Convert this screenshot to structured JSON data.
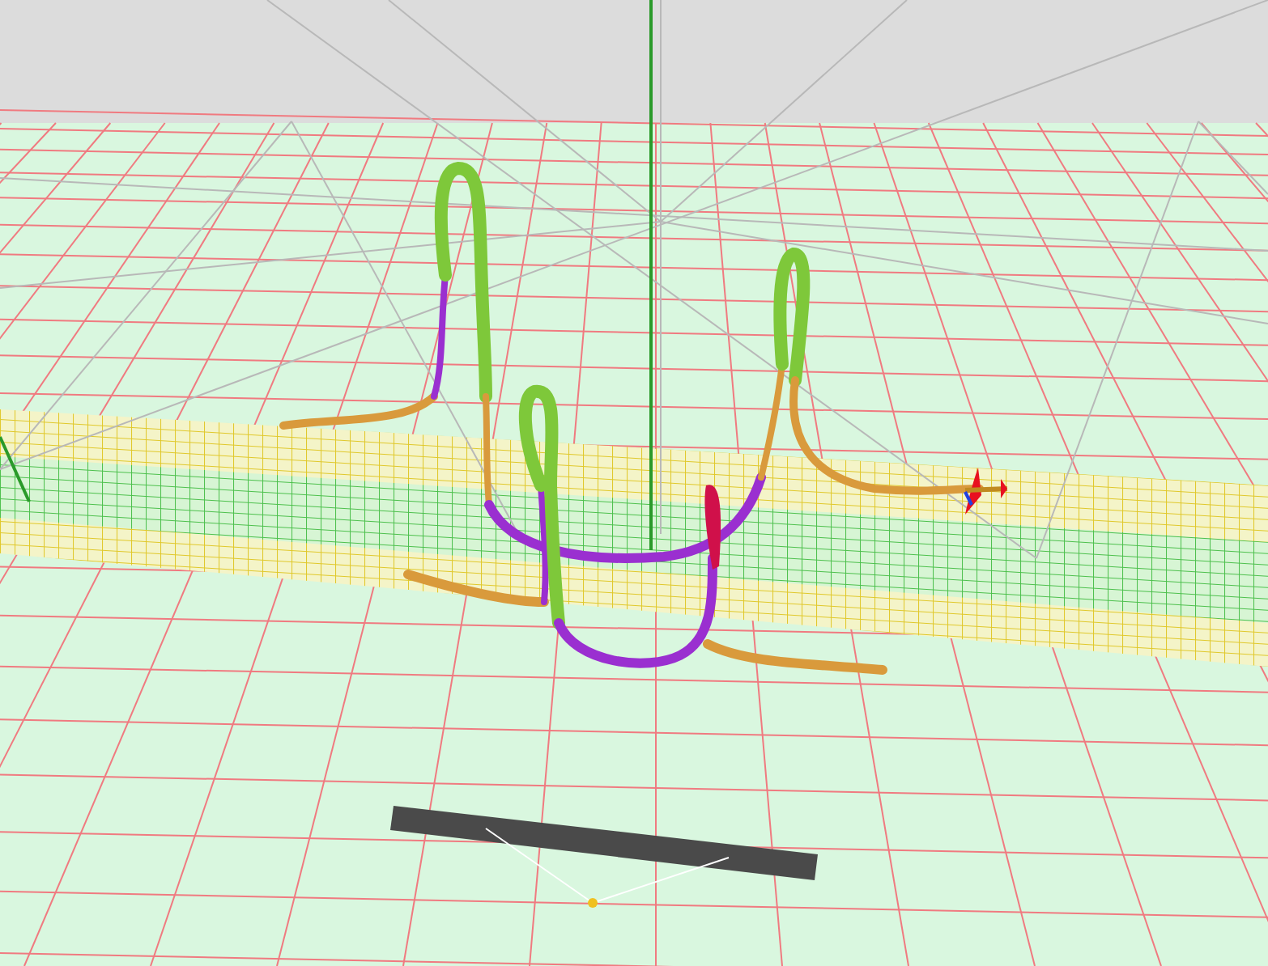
{
  "scene": {
    "kind": "trajectory-3d"
  }
}
